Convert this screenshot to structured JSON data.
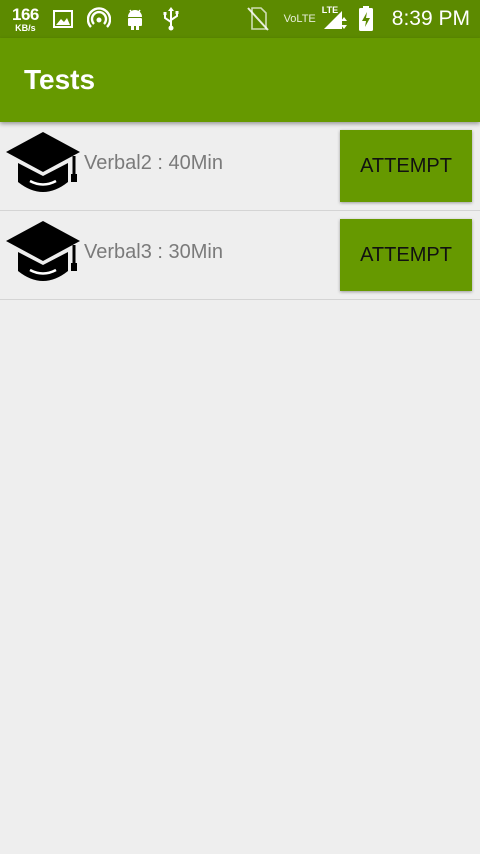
{
  "status_bar": {
    "net_speed": "166",
    "net_unit": "KB/s",
    "volte": "VoLTE",
    "lte": "LTE",
    "time": "8:39 PM",
    "icons": [
      "image-icon",
      "hotspot-icon",
      "android-icon",
      "usb-icon",
      "no-sim-icon",
      "signal-icon",
      "battery-charging-icon"
    ]
  },
  "app_bar": {
    "title": "Tests"
  },
  "tests": [
    {
      "label": "Verbal2 : 40Min",
      "button": "ATTEMPT",
      "icon": "graduation-cap-icon"
    },
    {
      "label": "Verbal3 : 30Min",
      "button": "ATTEMPT",
      "icon": "graduation-cap-icon"
    }
  ],
  "colors": {
    "primary": "#669900",
    "primary_dark": "#5c8a00",
    "background": "#eeeeee"
  }
}
